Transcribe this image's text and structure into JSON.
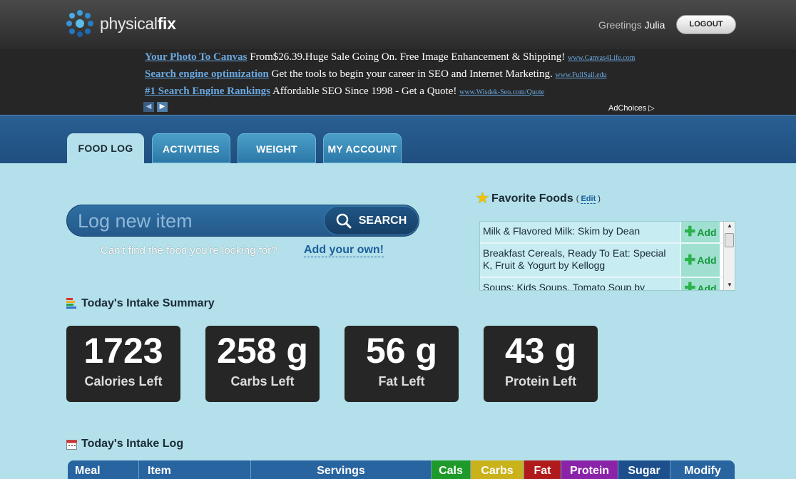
{
  "header": {
    "logo_word_light": "physical",
    "logo_word_bold": "fix",
    "greeting_prefix": "Greetings",
    "user_name": "Julia",
    "logout_label": "LOGOUT"
  },
  "ads": [
    {
      "title": "Your Photo To Canvas",
      "text": "From$26.39.Huge Sale Going On. Free Image Enhancement & Shipping!",
      "url": "www.Canvas4Life.com"
    },
    {
      "title": "Search engine optimization",
      "text": "Get the tools to begin your career in SEO and Internet Marketing.",
      "url": "www.FullSail.edu"
    },
    {
      "title": "#1 Search Engine Rankings",
      "text": "Affordable SEO Since 1998 - Get a Quote!",
      "url": "www.Wisdek-Seo.com/Quote"
    }
  ],
  "adchoices": "AdChoices",
  "tabs": [
    {
      "label": "FOOD LOG",
      "active": true
    },
    {
      "label": "ACTIVITIES",
      "active": false
    },
    {
      "label": "WEIGHT",
      "active": false
    },
    {
      "label": "MY ACCOUNT",
      "active": false
    }
  ],
  "search": {
    "placeholder": "Log new item",
    "button_label": "SEARCH",
    "cant_find": "Can't find the food you're looking for?",
    "add_own": "Add your own!"
  },
  "favorites": {
    "title": "Favorite Foods",
    "edit_label": "Edit",
    "add_label": "Add",
    "items": [
      "Milk & Flavored Milk: Skim by Dean",
      "Breakfast Cereals, Ready To Eat: Special K, Fruit & Yogurt by Kellogg",
      "Soups: Kids Soups, Tomato Soup by"
    ]
  },
  "summary": {
    "title": "Today's Intake Summary",
    "cards": [
      {
        "value": "1723",
        "label": "Calories Left"
      },
      {
        "value": "258 g",
        "label": "Carbs Left"
      },
      {
        "value": "56 g",
        "label": "Fat Left"
      },
      {
        "value": "43 g",
        "label": "Protein Left"
      }
    ]
  },
  "log": {
    "title": "Today's Intake Log",
    "columns": [
      "Meal",
      "Item",
      "Servings",
      "Cals",
      "Carbs",
      "Fat",
      "Protein",
      "Sugar",
      "Modify"
    ]
  },
  "colors": {
    "cals": "#1e9a2a",
    "carbs": "#c9b21a",
    "fat": "#b11a1a",
    "protein": "#8a23a8",
    "sugar": "#1d4f8c"
  }
}
